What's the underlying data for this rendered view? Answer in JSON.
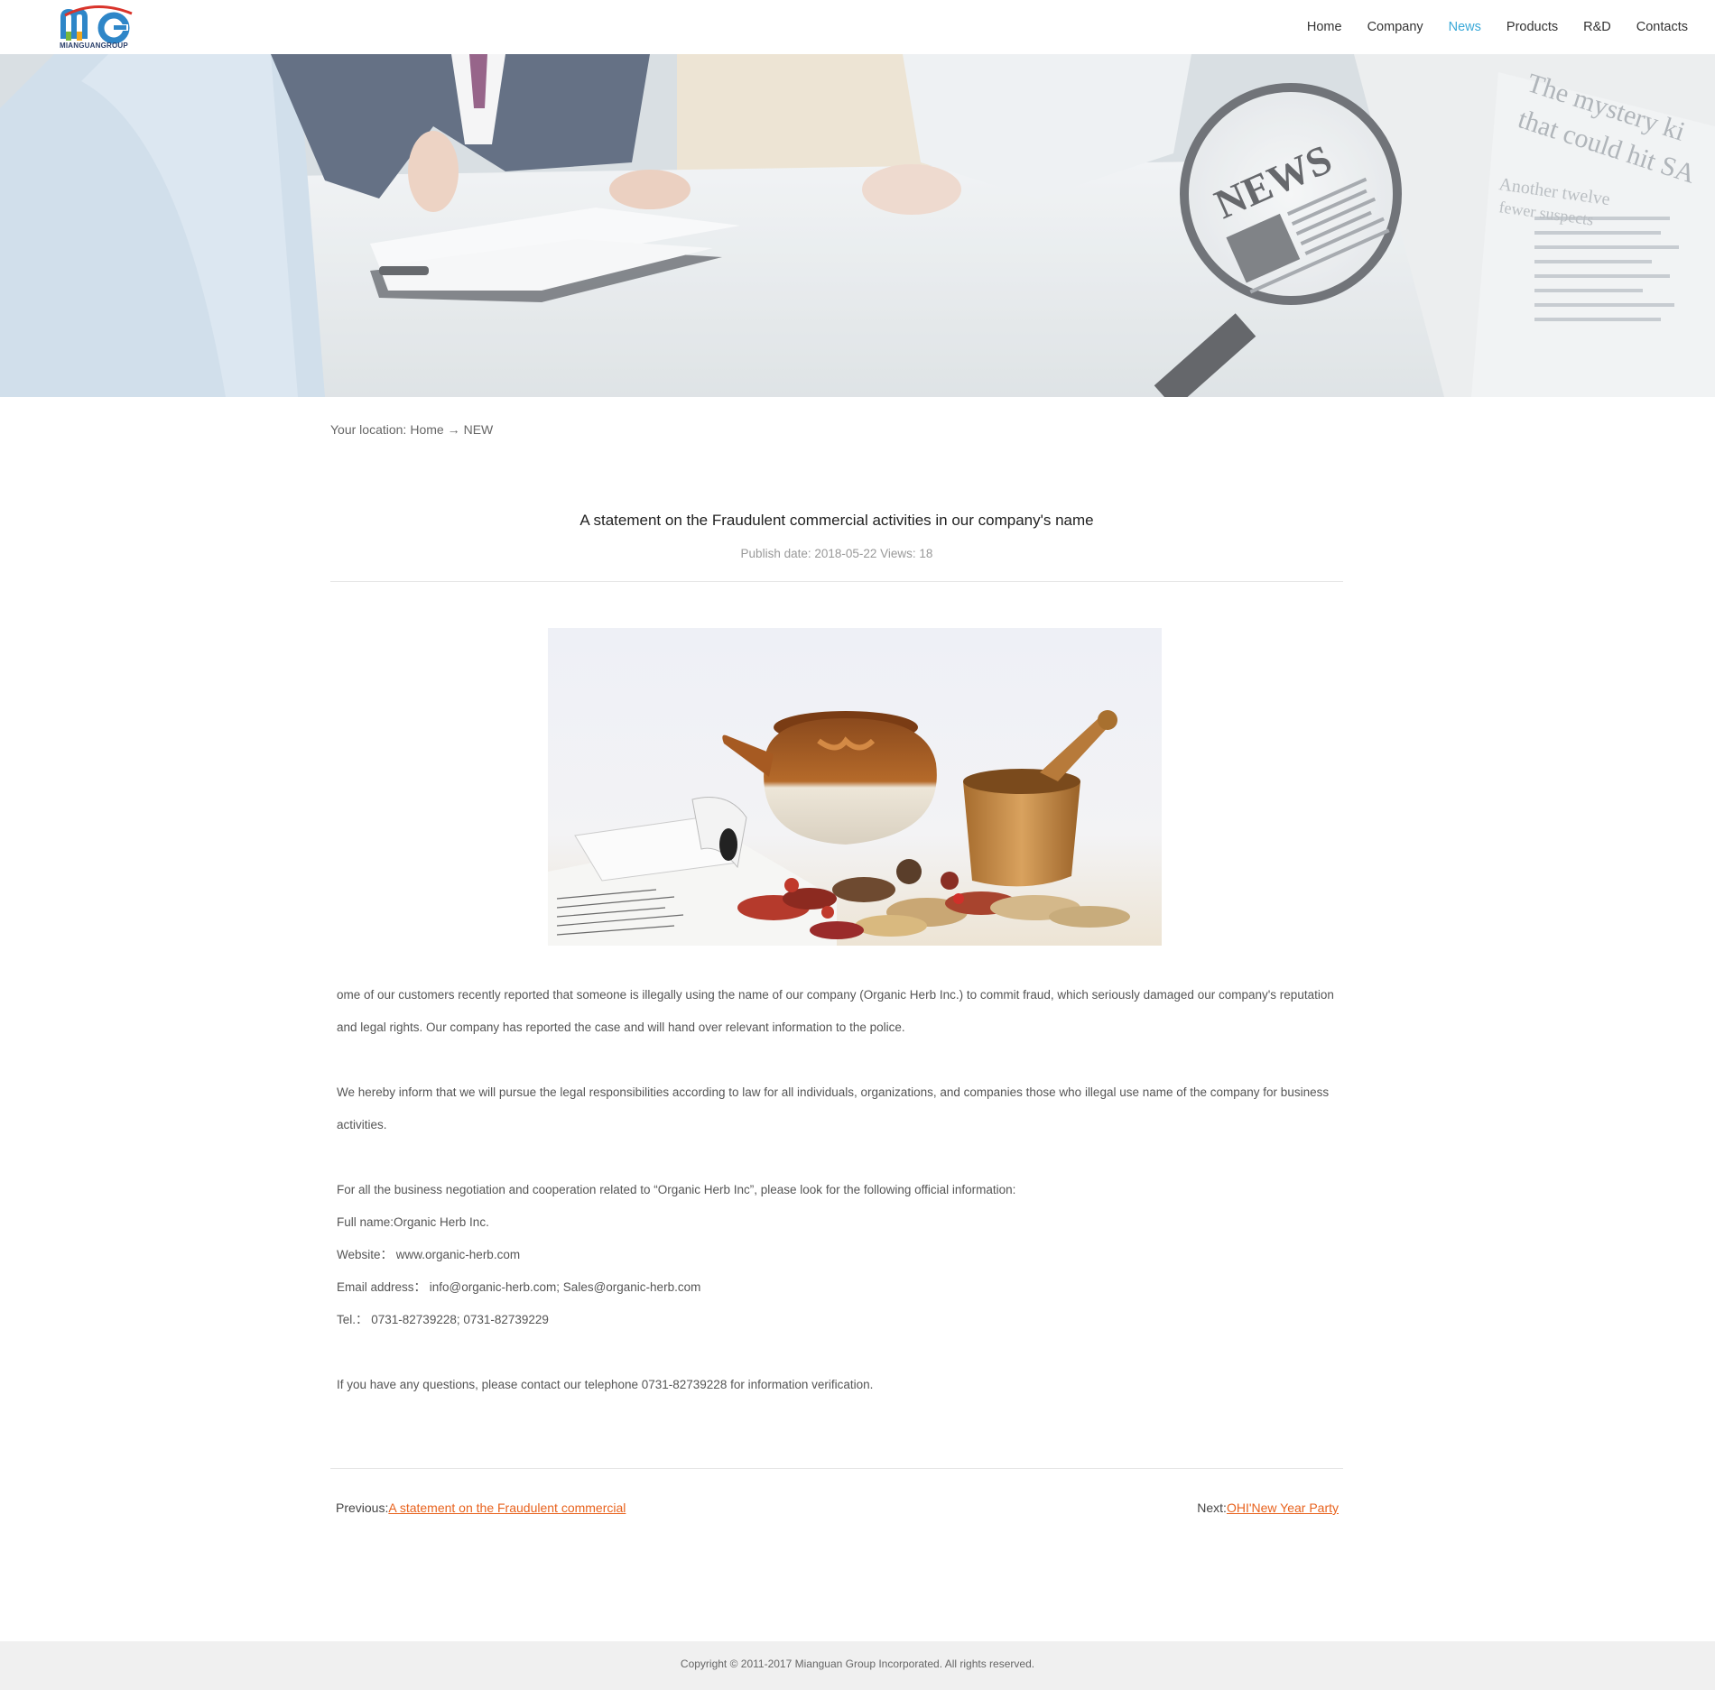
{
  "header": {
    "logo_text": "MIANGUANGROUP",
    "nav": [
      {
        "label": "Home"
      },
      {
        "label": "Company"
      },
      {
        "label": "News"
      },
      {
        "label": "Products"
      },
      {
        "label": "R&D"
      },
      {
        "label": "Contacts"
      }
    ],
    "active_nav": "News",
    "accent_color": "#39a8d8"
  },
  "banner": {
    "magnifier_text": "NEWS",
    "newspaper_lines": [
      "The mystery ki",
      "that could hit SA",
      "Another twelve",
      "fewer suspects"
    ]
  },
  "breadcrumb": {
    "prefix": "Your location:",
    "home": "Home",
    "arrow": "→",
    "current": "NEW"
  },
  "article": {
    "title": "A statement on the Fraudulent commercial activities in our company's name",
    "meta": "Publish date: 2018-05-22 Views: 18",
    "paragraphs": [
      "ome of our customers recently reported that someone is illegally using the name of our company (Organic Herb Inc.) to commit fraud, which seriously damaged our company's reputation and legal rights. Our company has reported the case and will hand over relevant information to the police.",
      "We hereby inform that we will pursue the legal responsibilities according to law for all individuals, organizations, and companies those who illegal use name of the company for business activities.",
      "For all the business negotiation and cooperation related to “Organic Herb Inc”, please look for the following official information:",
      "Full name:Organic Herb Inc.",
      "Website： www.organic-herb.com",
      "Email address： info@organic-herb.com; Sales@organic-herb.com",
      "Tel.： 0731-82739228; 0731-82739229",
      "If you have any questions, please contact our telephone 0731-82739228 for information verification."
    ]
  },
  "pager": {
    "prev_label": "Previous:",
    "prev_link": "A statement on the Fraudulent commercial",
    "next_label": "Next:",
    "next_link": "OHI'New Year Party",
    "link_color": "#e8621d"
  },
  "footer": {
    "copyright": "Copyright © 2011-2017 Mianguan Group Incorporated. All rights reserved."
  }
}
